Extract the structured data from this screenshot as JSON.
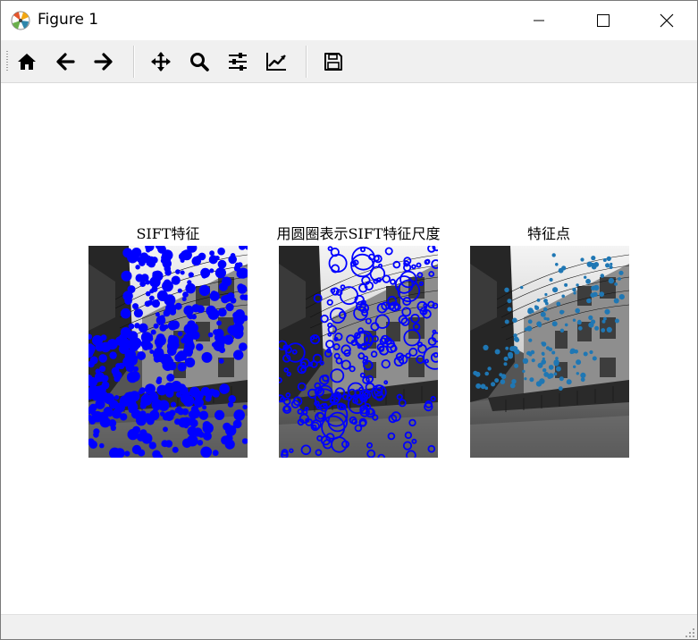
{
  "window": {
    "title": "Figure 1",
    "icons": {
      "app": "matplotlib-logo-icon",
      "minimize": "minimize-icon",
      "maximize": "maximize-icon",
      "close": "close-icon"
    }
  },
  "toolbar": {
    "buttons": [
      {
        "name": "home-button",
        "icon": "home-icon"
      },
      {
        "name": "back-button",
        "icon": "arrow-left-icon"
      },
      {
        "name": "forward-button",
        "icon": "arrow-right-icon"
      },
      {
        "name": "pan-button",
        "icon": "move-icon"
      },
      {
        "name": "zoom-button",
        "icon": "magnifier-icon"
      },
      {
        "name": "configure-subplots-button",
        "icon": "sliders-icon"
      },
      {
        "name": "edit-axis-button",
        "icon": "line-chart-icon"
      },
      {
        "name": "save-button",
        "icon": "floppy-disk-icon"
      }
    ]
  },
  "figure": {
    "subplots": [
      {
        "title": "SIFT特征",
        "marker_color": "#0000ff",
        "marker_style": "filled-dots"
      },
      {
        "title": "用圆圈表示SIFT特征尺度",
        "marker_color": "#0000ff",
        "marker_style": "circles"
      },
      {
        "title": "特征点",
        "marker_color": "#1f77b4",
        "marker_style": "small-dots"
      }
    ]
  },
  "colors": {
    "toolbar_bg": "#f0f0f0",
    "canvas_bg": "#ffffff",
    "sift_blue": "#0000ff",
    "feature_point_blue": "#1f77b4"
  }
}
